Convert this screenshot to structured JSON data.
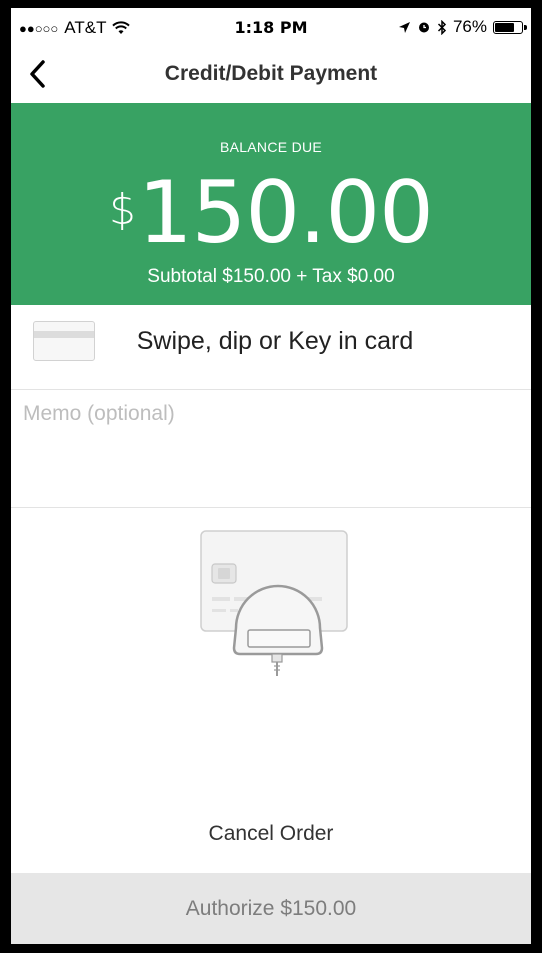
{
  "status_bar": {
    "signal": "●●○○○",
    "carrier": "AT&T",
    "time": "1:18 PM",
    "battery": "76%",
    "battery_level": 0.76
  },
  "nav": {
    "title": "Credit/Debit Payment"
  },
  "balance": {
    "label": "BALANCE DUE",
    "currency": "$",
    "amount": "150.00",
    "subtotal": "Subtotal $150.00 + Tax $0.00"
  },
  "card_entry": {
    "label": "Swipe, dip or Key in card"
  },
  "memo": {
    "placeholder": "Memo (optional)",
    "value": ""
  },
  "actions": {
    "cancel": "Cancel Order",
    "authorize": "Authorize $150.00"
  },
  "colors": {
    "accent": "#38a263",
    "button_bg": "#e6e6e6",
    "button_text": "#7d7d7d"
  }
}
